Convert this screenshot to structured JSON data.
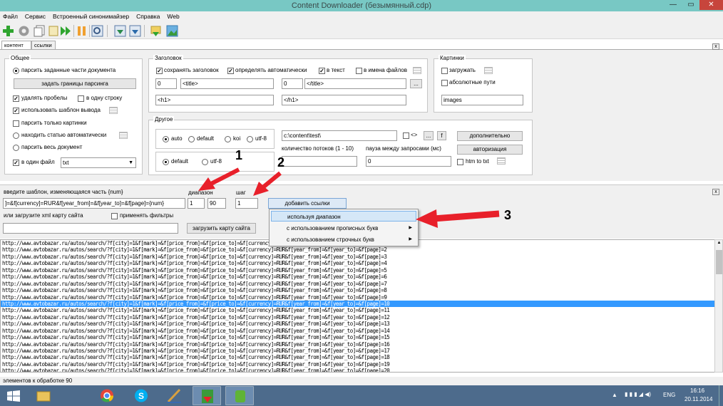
{
  "window": {
    "title": "Content Downloader (безымянный.cdp)",
    "min": "—",
    "max": "▭",
    "close": "✕"
  },
  "menu": [
    "Файл",
    "Сервис",
    "Встроенный синонимайзер",
    "Справка",
    "Web"
  ],
  "toolbar": {
    "icons": [
      "add-icon",
      "settings-icon",
      "copy-icon",
      "pages-icon",
      "play-icon",
      "pause-icon",
      "export-icon",
      "download-icon",
      "download-icon",
      "import-icon",
      "image-icon"
    ]
  },
  "tabs": {
    "content": "контент",
    "links": "ссылки",
    "close": "x"
  },
  "general": {
    "title": "Общее",
    "parse_parts": "парсить заданные части документа",
    "set_bounds": "задать границы парсинга",
    "remove_spaces": "удалять пробелы",
    "one_line": "в одну строку",
    "use_template": "использовать шаблон вывода",
    "only_images": "парсить только картинки",
    "find_article": "находить статью автоматически",
    "whole_doc": "парсить весь документ",
    "one_file": "в один файл",
    "file_type": "txt"
  },
  "headers": {
    "title": "Заголовок",
    "save_header": "сохранять заголовок",
    "auto_detect": "определять автоматически",
    "in_text": "в текст",
    "in_filenames": "в имена файлов",
    "num1": "0",
    "open_tag1": "<title>",
    "num2": "0",
    "close_tag1": "</title>",
    "dots": "...",
    "open_tag2": "<h1>",
    "close_tag2": "</h1>"
  },
  "images": {
    "title": "Картинки",
    "download": "загружать",
    "absolute": "абсолютные пути",
    "folder": "images"
  },
  "other": {
    "title": "Другое",
    "enc_auto": "auto",
    "enc_default": "default",
    "enc_koi": "koi",
    "enc_utf8": "utf-8",
    "out_default": "default",
    "out_utf8": "utf-8",
    "path": "c:\\content\\test\\",
    "tags": "<>",
    "dots": "...",
    "f": "f",
    "additional": "дополнительно",
    "auth": "авторизация",
    "threads_label": "количество потоков (1 - 10)",
    "pause_label": "пауза между запросами (мс)",
    "pause_value": "0",
    "htm_to_txt": "htm to txt"
  },
  "generator": {
    "template_label": "введите шаблон, изменяющаяся часть {num}",
    "template_value": "]=&f[currency]=RUR&f[year_from]=&f[year_to]=&f[page]={num}",
    "range_label": "диапазон",
    "range_from": "1",
    "range_to": "90",
    "step_label": "шаг",
    "step_value": "1",
    "add_links": "добавить ссылки",
    "xml_label": "или загрузите xml карту сайта",
    "apply_filters": "применять фильтры",
    "load_sitemap": "загрузить карту сайта",
    "close": "x"
  },
  "context_menu": [
    "используя диапазон",
    "с использованием прописных букв",
    "с использованием строчных букв"
  ],
  "annotations": [
    "1",
    "2",
    "3"
  ],
  "links": {
    "prefix": "http://www.avtobazar.ru/autos/search/?f[city]=1&f[mark]=&f[price_from]=&f[price_to]=&f[currency]=RUR&f[year_from]=&f[year_to]=&f[page]=",
    "pages": [
      "1",
      "2",
      "3",
      "4",
      "5",
      "6",
      "7",
      "8",
      "9",
      "10",
      "11",
      "12",
      "13",
      "14",
      "15",
      "16",
      "17",
      "18",
      "19",
      "20"
    ],
    "selected_index": 9
  },
  "status": "элементов к обработке 90",
  "tray": {
    "lang": "ENG",
    "time": "16:16",
    "date": "20.11.2014"
  },
  "colors": {
    "titlebar": "#78c8c4",
    "selection": "#3399ff",
    "taskbar": "#4d6b8c",
    "arrow": "#e8202a"
  }
}
